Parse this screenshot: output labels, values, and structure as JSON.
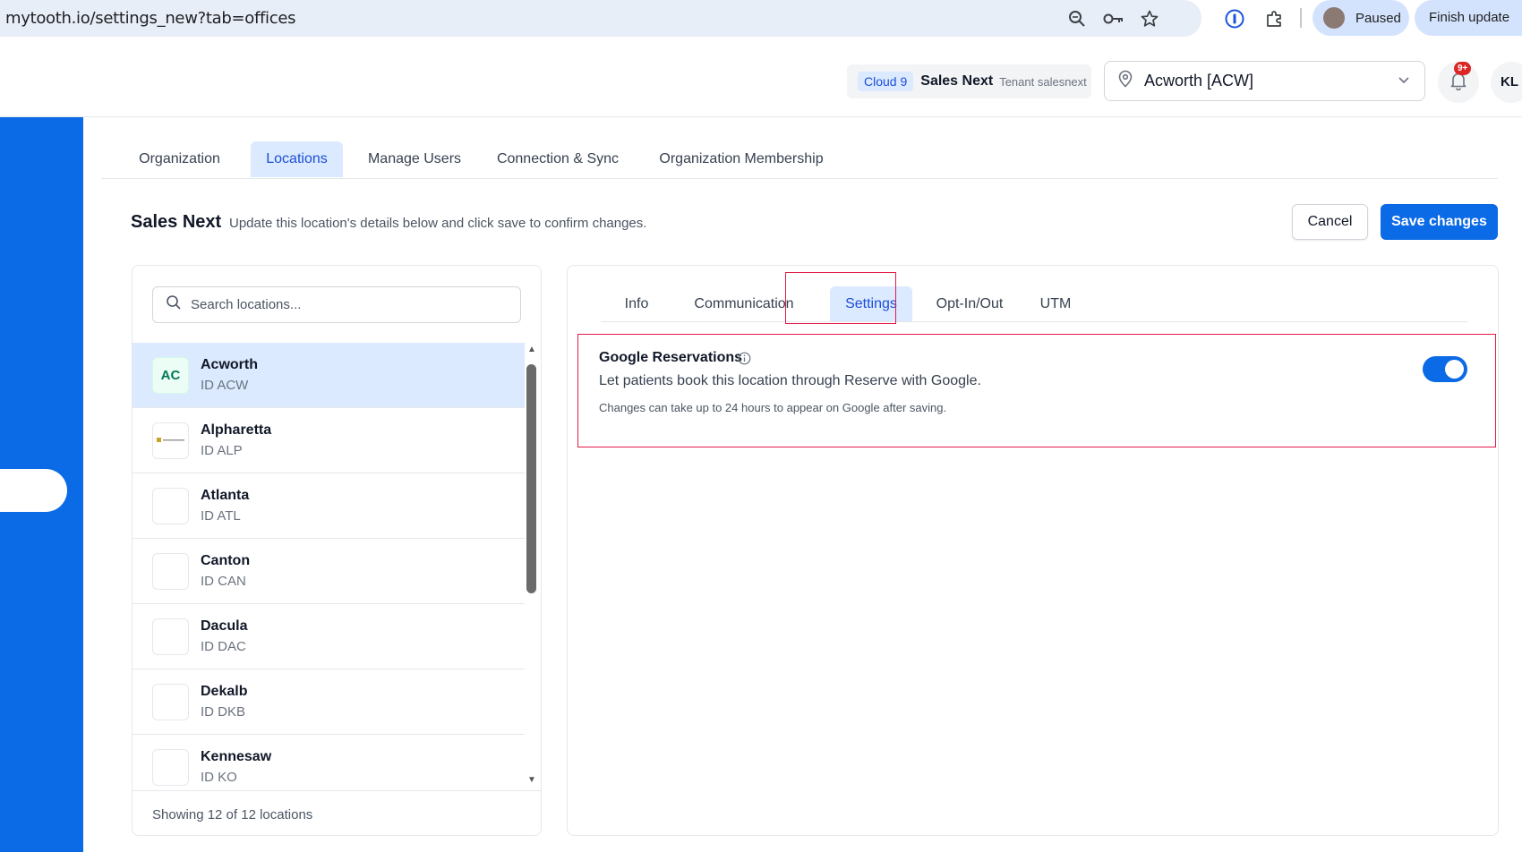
{
  "browser": {
    "url": "mytooth.io/settings_new?tab=offices",
    "profile_status": "Paused",
    "update_button": "Finish update"
  },
  "header": {
    "tenant": {
      "badge": "Cloud 9",
      "name": "Sales Next",
      "id_text": "Tenant salesnext"
    },
    "location_selector": "Acworth [ACW]",
    "notifications_count": "9+",
    "user_initials": "KL"
  },
  "top_tabs": [
    {
      "label": "Organization"
    },
    {
      "label": "Locations"
    },
    {
      "label": "Manage Users"
    },
    {
      "label": "Connection & Sync"
    },
    {
      "label": "Organization Membership"
    }
  ],
  "page": {
    "title": "Sales Next",
    "subtitle": "Update this location's details below and click save to confirm changes.",
    "cancel_label": "Cancel",
    "save_label": "Save changes"
  },
  "locations": {
    "search_placeholder": "Search locations...",
    "items": [
      {
        "initials": "AC",
        "name": "Acworth",
        "id": "ID ACW"
      },
      {
        "initials": "",
        "name": "Alpharetta",
        "id": "ID ALP"
      },
      {
        "initials": "",
        "name": "Atlanta",
        "id": "ID ATL"
      },
      {
        "initials": "",
        "name": "Canton",
        "id": "ID CAN"
      },
      {
        "initials": "",
        "name": "Dacula",
        "id": "ID DAC"
      },
      {
        "initials": "",
        "name": "Dekalb",
        "id": "ID DKB"
      },
      {
        "initials": "",
        "name": "Kennesaw",
        "id": "ID KO"
      }
    ],
    "footer": "Showing 12 of 12 locations"
  },
  "detail_tabs": [
    {
      "label": "Info"
    },
    {
      "label": "Communication"
    },
    {
      "label": "Settings"
    },
    {
      "label": "Opt-In/Out"
    },
    {
      "label": "UTM"
    }
  ],
  "google_reservations": {
    "title": "Google Reservations",
    "description": "Let patients book this location through Reserve with Google.",
    "note": "Changes can take up to 24 hours to appear on Google after saving.",
    "enabled": true
  },
  "colors": {
    "primary": "#0b6ae5",
    "active_tab_bg": "#dbeafe",
    "highlight_border": "#e11d48"
  }
}
